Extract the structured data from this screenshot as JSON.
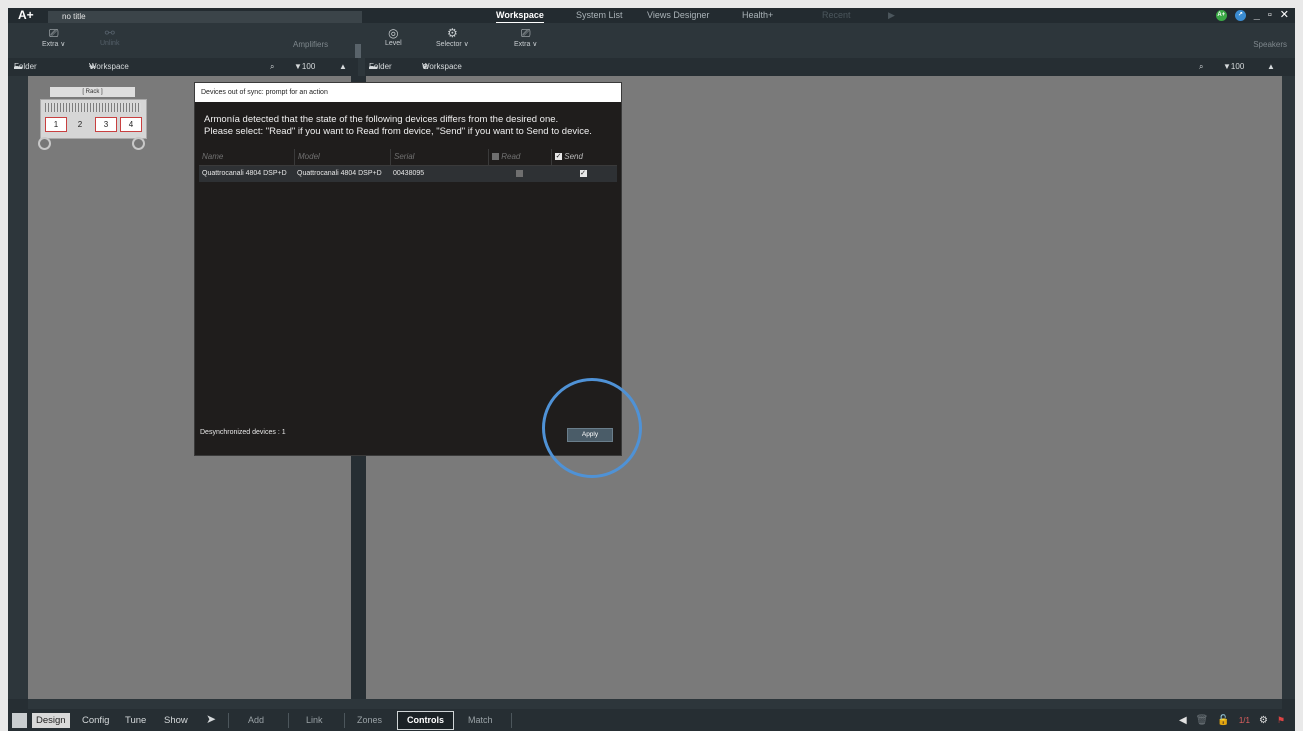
{
  "app": {
    "logo": "A+",
    "doc_title": "no title",
    "nav_tabs": [
      "Workspace",
      "System List",
      "Views Designer",
      "Health+",
      "Recent"
    ],
    "header_right_label": "Speakers"
  },
  "toolbar_left": {
    "extra": "Extra",
    "unlink": "Unlink",
    "section": "Amplifiers"
  },
  "toolbar_right": {
    "level": "Level",
    "selector": "Selector",
    "extra": "Extra"
  },
  "panel_left_header": {
    "folder": "Folder",
    "workspace": "Workspace",
    "zoom": "100 %"
  },
  "panel_right_header": {
    "folder": "Folder",
    "workspace": "Workspace",
    "zoom": "100 %"
  },
  "rack": {
    "label": "[ Rack ]",
    "channels": [
      "1",
      "2",
      "3",
      "4"
    ]
  },
  "dialog": {
    "title": "Devices out of sync: prompt for an action",
    "message_line1": "Armonía detected that the state of the following devices differs from the desired one.",
    "message_line2": "Please select: \"Read\" if you want to Read from device, \"Send\" if you want to Send to device.",
    "columns": {
      "name": "Name",
      "model": "Model",
      "serial": "Serial",
      "read": "Read",
      "send": "Send"
    },
    "rows": [
      {
        "name": "Quattrocanali 4804 DSP+D",
        "model": "Quattrocanali 4804 DSP+D",
        "serial": "00438095",
        "read": false,
        "send": true
      }
    ],
    "status": "Desynchronized devices : 1",
    "apply": "Apply"
  },
  "bottom": {
    "modes": [
      "Design",
      "Config",
      "Tune",
      "Show"
    ],
    "tabs": [
      "Add",
      "Link",
      "Zones",
      "Controls",
      "Match"
    ],
    "page_counter": "1/1"
  },
  "colors": {
    "accent_circle": "#4f92d6",
    "panel_bg": "#7a7a7a",
    "chrome": "#2d363b"
  }
}
